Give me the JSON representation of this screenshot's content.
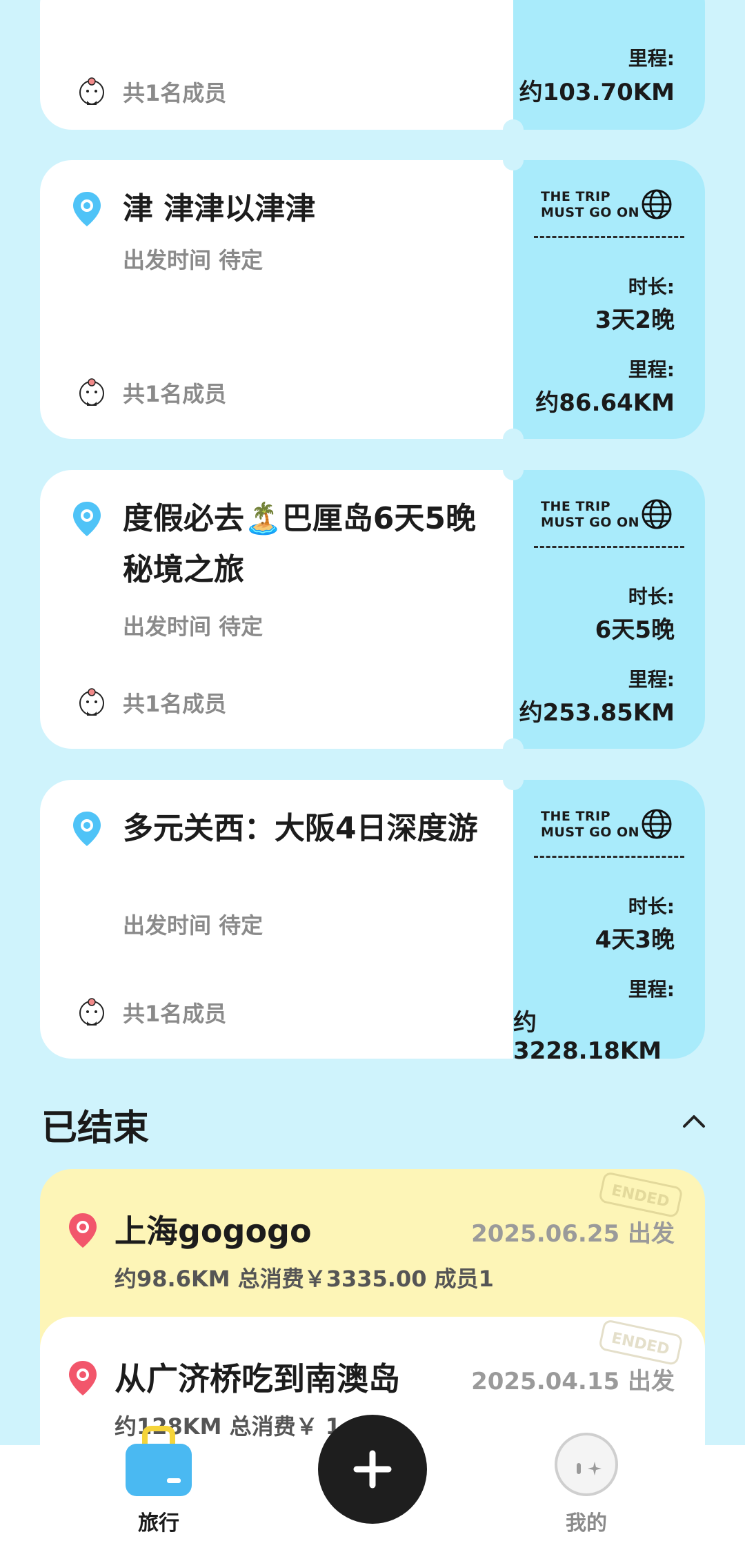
{
  "cards": [
    {
      "title": "",
      "depart": "",
      "members": "共1名成员",
      "brand": "",
      "duration_label": "",
      "duration": "",
      "distance_label": "里程:",
      "distance": "约103.70KM"
    },
    {
      "title": "津 津津以津津",
      "depart": "出发时间 待定",
      "members": "共1名成员",
      "brand": "THE TRIP\nMUST GO ON",
      "duration_label": "时长:",
      "duration": "3天2晚",
      "distance_label": "里程:",
      "distance": "约86.64KM"
    },
    {
      "title": "度假必去🏝️巴厘岛6天5晚秘境之旅",
      "depart": "出发时间 待定",
      "members": "共1名成员",
      "brand": "THE TRIP\nMUST GO ON",
      "duration_label": "时长:",
      "duration": "6天5晚",
      "distance_label": "里程:",
      "distance": "约253.85KM"
    },
    {
      "title": "多元关西：大阪4日深度游",
      "depart": "出发时间 待定",
      "members": "共1名成员",
      "brand": "THE TRIP\nMUST GO ON",
      "duration_label": "时长:",
      "duration": "4天3晚",
      "distance_label": "里程:",
      "distance": "约3228.18KM"
    }
  ],
  "ended_section": {
    "title": "已结束",
    "stamp_text": "ENDED",
    "items": [
      {
        "title": "上海gogogo",
        "date": "2025.06.25 出发",
        "meta": "约98.6KM 总消费￥3335.00 成员1"
      },
      {
        "title": "从广济桥吃到南澳岛",
        "date": "2025.04.15 出发",
        "meta": "约128KM 总消费￥            1"
      }
    ]
  },
  "nav": {
    "travel_label": "旅行",
    "mine_label": "我的",
    "plus_symbol": "+"
  },
  "colors": {
    "background": "#cff3fc",
    "stub": "#a9ebfb",
    "pin_blue": "#4fc3f7",
    "pin_red": "#f2566b",
    "ended_yellow": "#fdf5b7"
  }
}
